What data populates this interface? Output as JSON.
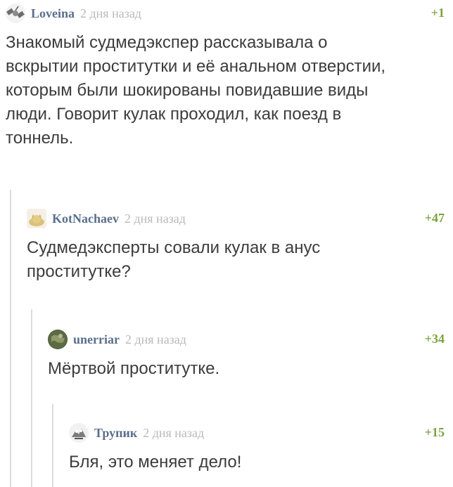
{
  "comments": [
    {
      "username": "Loveina",
      "time": "2 дня назад",
      "rating": "+1",
      "avatar": "satellite-icon",
      "text": "Знакомый судмедэкспер рассказывала о вскрытии проститутки и её анальном отверстии, которым были шокированы повидавшие виды люди. Говорит кулак проходил, как поезд в тоннель."
    },
    {
      "username": "KotNachaev",
      "time": "2 дня назад",
      "rating": "+47",
      "avatar": "cat-icon",
      "text": "Судмедэксперты совали кулак в анус проститутке?"
    },
    {
      "username": "unerriar",
      "time": "2 дня назад",
      "rating": "+34",
      "avatar": "globe-icon",
      "text": "Мёртвой проститутке."
    },
    {
      "username": "Трупик",
      "time": "2 дня назад",
      "rating": "+15",
      "avatar": "creature-icon",
      "text": "Бля, это меняет дело!"
    }
  ],
  "colors": {
    "username": "#5a6f8c",
    "time": "#b9b9b9",
    "rating": "#7aa33d",
    "text": "#3c3c3c",
    "thread_line": "#dcdcdc"
  }
}
